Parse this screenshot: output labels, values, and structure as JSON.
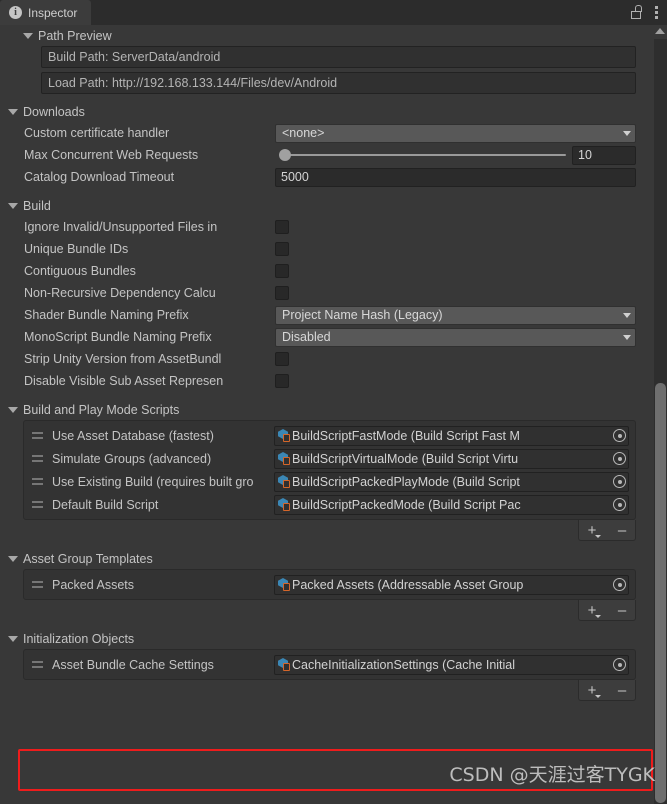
{
  "window": {
    "tab_label": "Inspector",
    "info_icon": "info-icon",
    "lock_icon": "lock-icon",
    "menu_icon": "kebab-menu-icon"
  },
  "sections": {
    "path_preview": {
      "title": "Path Preview",
      "build_path": "Build Path: ServerData/android",
      "load_path": "Load Path: http://192.168.133.144/Files/dev/Android"
    },
    "downloads": {
      "title": "Downloads",
      "custom_certificate_handler": {
        "label": "Custom certificate handler",
        "value": "<none>"
      },
      "max_concurrent_web_requests": {
        "label": "Max Concurrent Web Requests",
        "value": "10"
      },
      "catalog_download_timeout": {
        "label": "Catalog Download Timeout",
        "value": "5000"
      }
    },
    "build": {
      "title": "Build",
      "checkboxes": [
        {
          "label": "Ignore Invalid/Unsupported Files in",
          "checked": false
        },
        {
          "label": "Unique Bundle IDs",
          "checked": false
        },
        {
          "label": "Contiguous Bundles",
          "checked": false
        },
        {
          "label": "Non-Recursive Dependency Calcu",
          "checked": false
        }
      ],
      "shader_bundle_naming_prefix": {
        "label": "Shader Bundle Naming Prefix",
        "value": "Project Name Hash (Legacy)"
      },
      "monoscript_bundle_naming_prefix": {
        "label": "MonoScript Bundle Naming Prefix",
        "value": "Disabled"
      },
      "checkboxes2": [
        {
          "label": "Strip Unity Version from AssetBundl",
          "checked": false
        },
        {
          "label": "Disable Visible Sub Asset Represen",
          "checked": false
        }
      ]
    },
    "build_and_play_mode_scripts": {
      "title": "Build and Play Mode Scripts",
      "rows": [
        {
          "label": "Use Asset Database (fastest)",
          "object": "BuildScriptFastMode (Build Script Fast M"
        },
        {
          "label": "Simulate Groups (advanced)",
          "object": "BuildScriptVirtualMode (Build Script Virtu"
        },
        {
          "label": "Use Existing Build (requires built gro",
          "object": "BuildScriptPackedPlayMode (Build Script"
        },
        {
          "label": "Default Build Script",
          "object": "BuildScriptPackedMode (Build Script Pac"
        }
      ],
      "add_label": "+",
      "remove_label": "–"
    },
    "asset_group_templates": {
      "title": "Asset Group Templates",
      "rows": [
        {
          "label": "Packed Assets",
          "object": "Packed Assets (Addressable Asset Group"
        }
      ],
      "add_label": "+",
      "remove_label": "–"
    },
    "initialization_objects": {
      "title": "Initialization Objects",
      "rows": [
        {
          "label": "Asset Bundle Cache Settings",
          "object": "CacheInitializationSettings (Cache Initial"
        }
      ],
      "add_label": "+",
      "remove_label": "–"
    }
  },
  "annotation": {
    "highlight_color": "#ee1c1c",
    "watermark": "CSDN @天涯过客TYGK"
  }
}
